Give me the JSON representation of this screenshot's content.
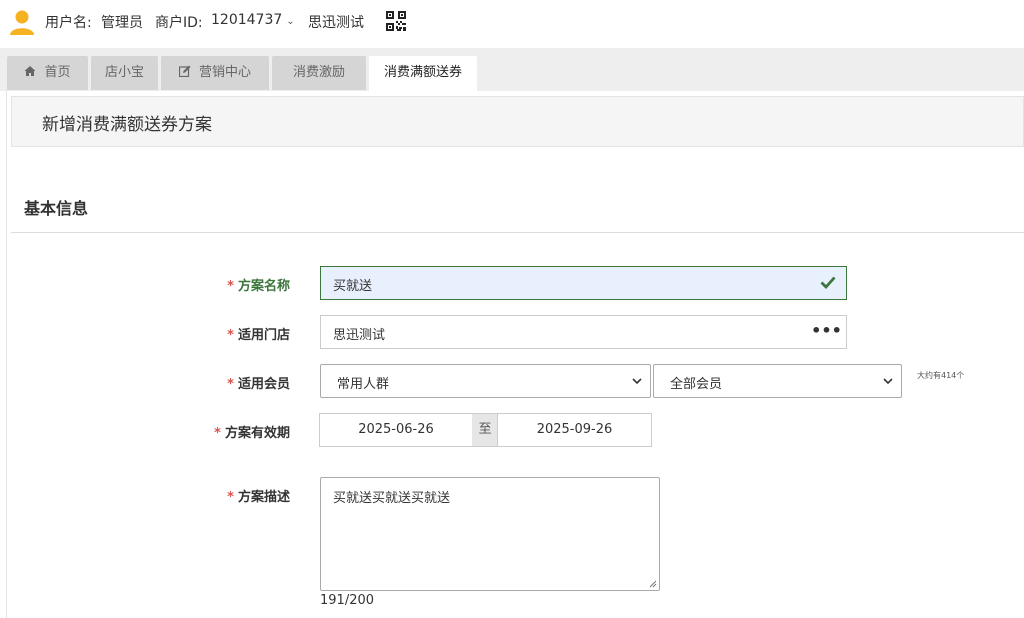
{
  "header": {
    "username_label": "用户名:",
    "username": "管理员",
    "merchant_label": "商户ID:",
    "merchant_id": "12014737",
    "store_name": "思迅测试"
  },
  "tabs": [
    {
      "label": "首页",
      "icon": "home-icon"
    },
    {
      "label": "店小宝"
    },
    {
      "label": "营销中心",
      "icon": "edit-icon"
    },
    {
      "label": "消费激励"
    },
    {
      "label": "消费满额送券",
      "active": true
    }
  ],
  "page": {
    "title": "新增消费满额送券方案",
    "section_title": "基本信息"
  },
  "form": {
    "name_label": "方案名称",
    "name_value": "买就送",
    "store_label": "适用门店",
    "store_value": "思迅测试",
    "member_label": "适用会员",
    "member_group_value": "常用人群",
    "member_scope_value": "全部会员",
    "member_count_note": "大约有414个",
    "validity_label": "方案有效期",
    "start_date": "2025-06-26",
    "date_separator": "至",
    "end_date": "2025-09-26",
    "desc_label": "方案描述",
    "desc_value": "买就送买就送买就送",
    "desc_counter": "191/200",
    "required_mark": "*"
  },
  "colors": {
    "required": "#d9534f",
    "success": "#3c763d",
    "avatar": "#f5b324"
  }
}
